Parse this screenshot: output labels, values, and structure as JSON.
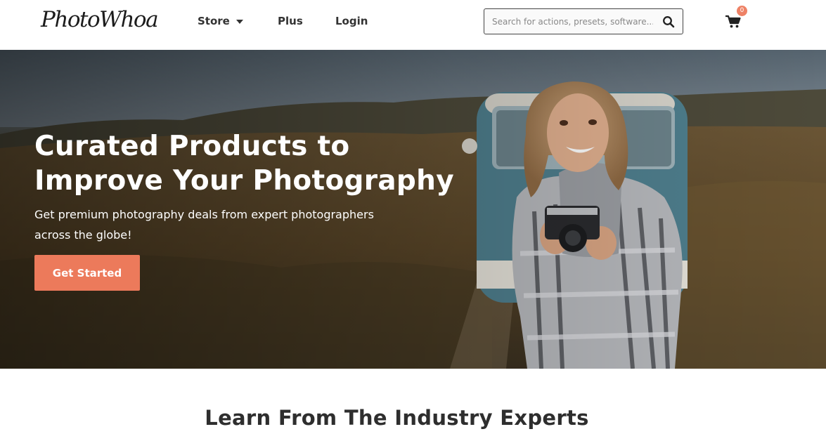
{
  "header": {
    "logo": "PhotoWhoa",
    "nav": {
      "store": "Store",
      "plus": "Plus",
      "login": "Login"
    },
    "search": {
      "placeholder": "Search for actions, presets, software..."
    },
    "cart_count": "0"
  },
  "hero": {
    "title": "Curated Products to Improve Your Photography",
    "subtitle": "Get premium photography deals from expert photographers across the globe!",
    "cta_label": "Get Started"
  },
  "section": {
    "title": "Learn From The Industry Experts"
  },
  "colors": {
    "accent": "#ec7a5b",
    "badge": "#ee8266",
    "text_dark": "#2e2e2e"
  },
  "icons": [
    "chevron-down-icon",
    "search-icon",
    "cart-icon"
  ]
}
